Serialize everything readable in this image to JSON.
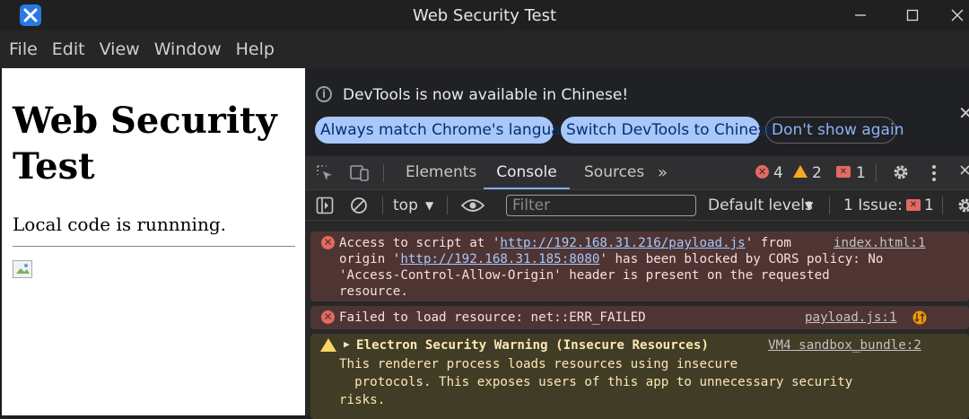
{
  "window": {
    "title": "Web Security Test",
    "controls": [
      "minimize",
      "maximize",
      "close"
    ]
  },
  "menu": [
    "File",
    "Edit",
    "View",
    "Window",
    "Help"
  ],
  "page": {
    "heading": "Web Security Test",
    "paragraph": "Local code is runnning."
  },
  "devtools": {
    "infobar": {
      "message": "DevTools is now available in Chinese!",
      "btn_match": "Always match Chrome's language",
      "btn_switch": "Switch DevTools to Chinese",
      "btn_dismiss": "Don't show again"
    },
    "tabs": [
      "Elements",
      "Console",
      "Sources"
    ],
    "active_tab": "Console",
    "counts": {
      "errors": "4",
      "warnings": "2",
      "issues": "1"
    },
    "console_toolbar": {
      "context": "top",
      "filter_placeholder": "Filter",
      "levels": "Default levels",
      "issues_label": "1 Issue:",
      "issues_count": "1"
    },
    "messages": [
      {
        "level": "error",
        "pre": "Access to script at '",
        "url1": "http://192.168.31.216/payload.js",
        "mid1": "' from",
        "source": "index.html:1",
        "line2_pre": "origin '",
        "url2": "http://192.168.31.185:8080",
        "line2_post": "' has been blocked by CORS policy: No",
        "line3": "'Access-Control-Allow-Origin' header is present on the requested",
        "line4": "resource."
      },
      {
        "level": "error",
        "text": "Failed to load resource: net::ERR_FAILED",
        "source": "payload.js:1"
      },
      {
        "level": "warning",
        "title": "Electron Security Warning (Insecure Resources)",
        "source": "VM4 sandbox_bundle:2",
        "line2": "This renderer process loads resources using insecure",
        "line3": "  protocols. This exposes users of this app to unnecessary security",
        "line4": "risks."
      }
    ]
  },
  "colors": {
    "accent": "#7cacf8",
    "error_bg": "#4e3534",
    "warning_bg": "#413c26",
    "error_icon": "#e46962",
    "warning_icon": "#fdd663"
  }
}
